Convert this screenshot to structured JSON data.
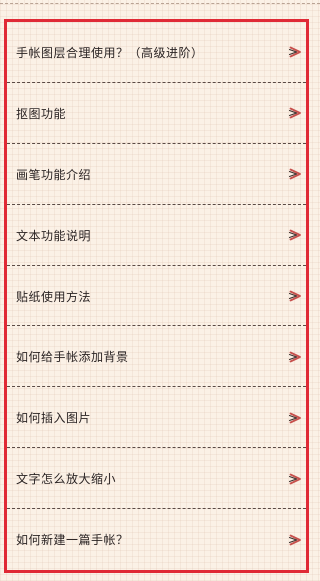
{
  "help_list": {
    "items": [
      {
        "label": "手帐图层合理使用？（高级进阶）",
        "icon": "chevron-right-icon"
      },
      {
        "label": "抠图功能",
        "icon": "chevron-right-icon"
      },
      {
        "label": "画笔功能介绍",
        "icon": "chevron-right-icon"
      },
      {
        "label": "文本功能说明",
        "icon": "chevron-right-icon"
      },
      {
        "label": "贴纸使用方法",
        "icon": "chevron-right-icon"
      },
      {
        "label": "如何给手帐添加背景",
        "icon": "chevron-right-icon"
      },
      {
        "label": "如何插入图片",
        "icon": "chevron-right-icon"
      },
      {
        "label": "文字怎么放大缩小",
        "icon": "chevron-right-icon"
      },
      {
        "label": "如何新建一篇手帐？",
        "icon": "chevron-right-icon"
      }
    ]
  },
  "colors": {
    "background": "#fbf1e6",
    "highlight_frame": "#e02a36",
    "chevron": "#c7514d",
    "text": "#2b2424"
  }
}
